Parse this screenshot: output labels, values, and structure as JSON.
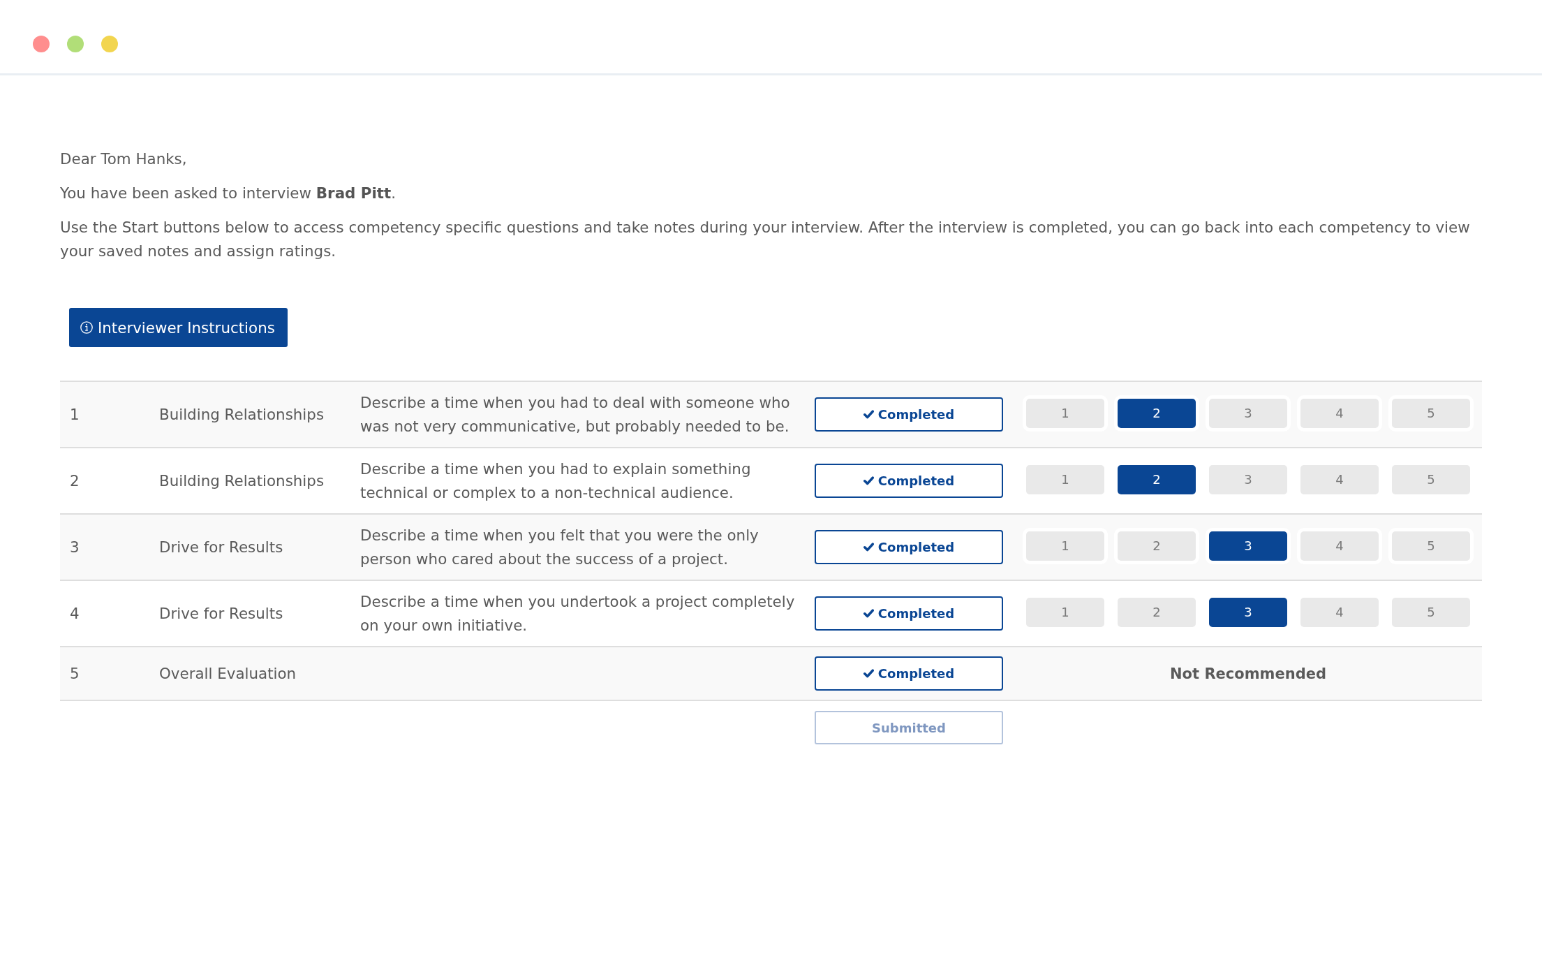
{
  "window_controls": [
    {
      "color": "#ff8e8e"
    },
    {
      "color": "#b1de78"
    },
    {
      "color": "#f2d54f"
    }
  ],
  "greeting": "Dear Tom Hanks,",
  "assignment": "You have been asked to interview **Brad Pitt**.",
  "instructions": "Use the Start buttons below to access competency specific questions and take notes during your interview. After the interview is completed, you can go back into each competency to view your saved notes and assign ratings.",
  "instructions_button": {
    "label": "Interviewer Instructions"
  },
  "competencies": [
    {
      "kind": "question",
      "number": "1",
      "competency": "Building Relationships",
      "question": "Describe a time when you had to deal with someone who was not very communicative, but probably needed to be.",
      "status": {
        "label": "Completed",
        "completed": true
      },
      "ratings": [
        {
          "label": "1",
          "selected": false
        },
        {
          "label": "2",
          "selected": true
        },
        {
          "label": "3",
          "selected": false
        },
        {
          "label": "4",
          "selected": false
        },
        {
          "label": "5",
          "selected": false
        }
      ]
    },
    {
      "kind": "question",
      "number": "2",
      "competency": "Building Relationships",
      "question": "Describe a time when you had to explain something technical or complex to a non-technical audience.",
      "status": {
        "label": "Completed",
        "completed": true
      },
      "ratings": [
        {
          "label": "1",
          "selected": false
        },
        {
          "label": "2",
          "selected": true
        },
        {
          "label": "3",
          "selected": false
        },
        {
          "label": "4",
          "selected": false
        },
        {
          "label": "5",
          "selected": false
        }
      ]
    },
    {
      "kind": "question",
      "number": "3",
      "competency": "Drive for Results",
      "question": "Describe a time when you felt that you were the only person who cared about the success of a project.",
      "status": {
        "label": "Completed",
        "completed": true
      },
      "ratings": [
        {
          "label": "1",
          "selected": false
        },
        {
          "label": "2",
          "selected": false
        },
        {
          "label": "3",
          "selected": true
        },
        {
          "label": "4",
          "selected": false
        },
        {
          "label": "5",
          "selected": false
        }
      ]
    },
    {
      "kind": "question",
      "number": "4",
      "competency": "Drive for Results",
      "question": "Describe a time when you undertook a project completely on your own initiative.",
      "status": {
        "label": "Completed",
        "completed": true
      },
      "ratings": [
        {
          "label": "1",
          "selected": false
        },
        {
          "label": "2",
          "selected": false
        },
        {
          "label": "3",
          "selected": true
        },
        {
          "label": "4",
          "selected": false
        },
        {
          "label": "5",
          "selected": false
        }
      ]
    },
    {
      "kind": "evaluation",
      "number": "5",
      "competency": "Overall Evaluation",
      "status": {
        "label": "Completed",
        "completed": true
      },
      "recommendation": "Not Recommended"
    }
  ],
  "submit_button": {
    "label": "Submitted",
    "disabled": true
  }
}
